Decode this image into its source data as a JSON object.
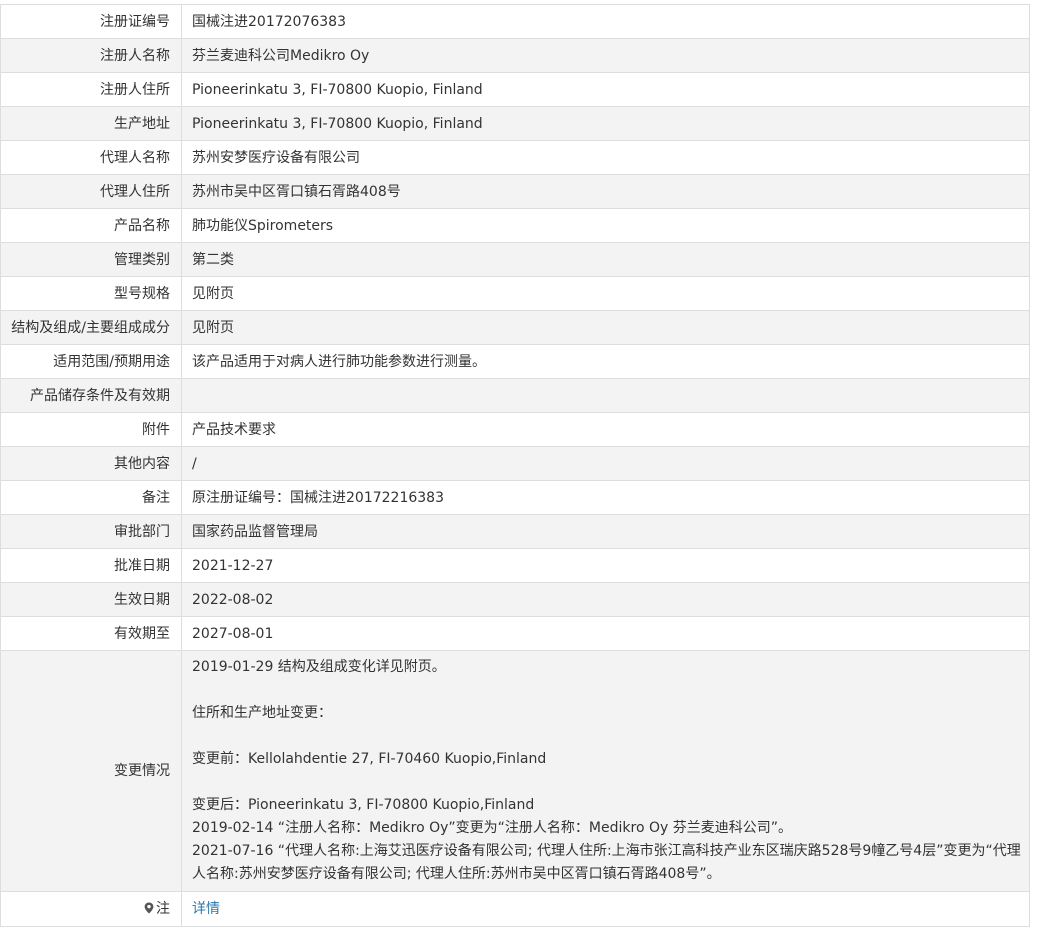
{
  "rows": [
    {
      "label": "注册证编号",
      "value": "国械注进20172076383"
    },
    {
      "label": "注册人名称",
      "value": "芬兰麦迪科公司Medikro Oy"
    },
    {
      "label": "注册人住所",
      "value": "Pioneerinkatu 3, FI-70800 Kuopio, Finland"
    },
    {
      "label": "生产地址",
      "value": "Pioneerinkatu 3, FI-70800 Kuopio, Finland"
    },
    {
      "label": "代理人名称",
      "value": "苏州安梦医疗设备有限公司"
    },
    {
      "label": "代理人住所",
      "value": "苏州市吴中区胥口镇石胥路408号"
    },
    {
      "label": "产品名称",
      "value": "肺功能仪Spirometers"
    },
    {
      "label": "管理类别",
      "value": "第二类"
    },
    {
      "label": "型号规格",
      "value": "见附页"
    },
    {
      "label": "结构及组成/主要组成成分",
      "value": "见附页"
    },
    {
      "label": "适用范围/预期用途",
      "value": "该产品适用于对病人进行肺功能参数进行测量。"
    },
    {
      "label": "产品储存条件及有效期",
      "value": ""
    },
    {
      "label": "附件",
      "value": "产品技术要求"
    },
    {
      "label": "其他内容",
      "value": "/"
    },
    {
      "label": "备注",
      "value": "原注册证编号：国械注进20172216383"
    },
    {
      "label": "审批部门",
      "value": "国家药品监督管理局"
    },
    {
      "label": "批准日期",
      "value": "2021-12-27"
    },
    {
      "label": "生效日期",
      "value": "2022-08-02"
    },
    {
      "label": "有效期至",
      "value": "2027-08-01"
    }
  ],
  "changes": {
    "label": "变更情况",
    "lines": [
      "2019-01-29 结构及组成变化详见附页。",
      "",
      "住所和生产地址变更：",
      "",
      "变更前：Kellolahdentie 27, FI-70460 Kuopio,Finland",
      "",
      "变更后：Pioneerinkatu 3, FI-70800 Kuopio,Finland",
      "2019-02-14 “注册人名称：Medikro Oy”变更为“注册人名称：Medikro Oy 芬兰麦迪科公司”。",
      "2021-07-16 “代理人名称:上海艾迅医疗设备有限公司; 代理人住所:上海市张江高科技产业东区瑞庆路528号9幢乙号4层”变更为“代理人名称:苏州安梦医疗设备有限公司; 代理人住所:苏州市吴中区胥口镇石胥路408号”。"
    ]
  },
  "note": {
    "label": "注",
    "icon": "location-pin-icon",
    "link_text": "详情"
  },
  "colors": {
    "border": "#dddddd",
    "alt_row_bg": "#f3f3f3",
    "text": "#333333",
    "link": "#2a7ab0"
  }
}
